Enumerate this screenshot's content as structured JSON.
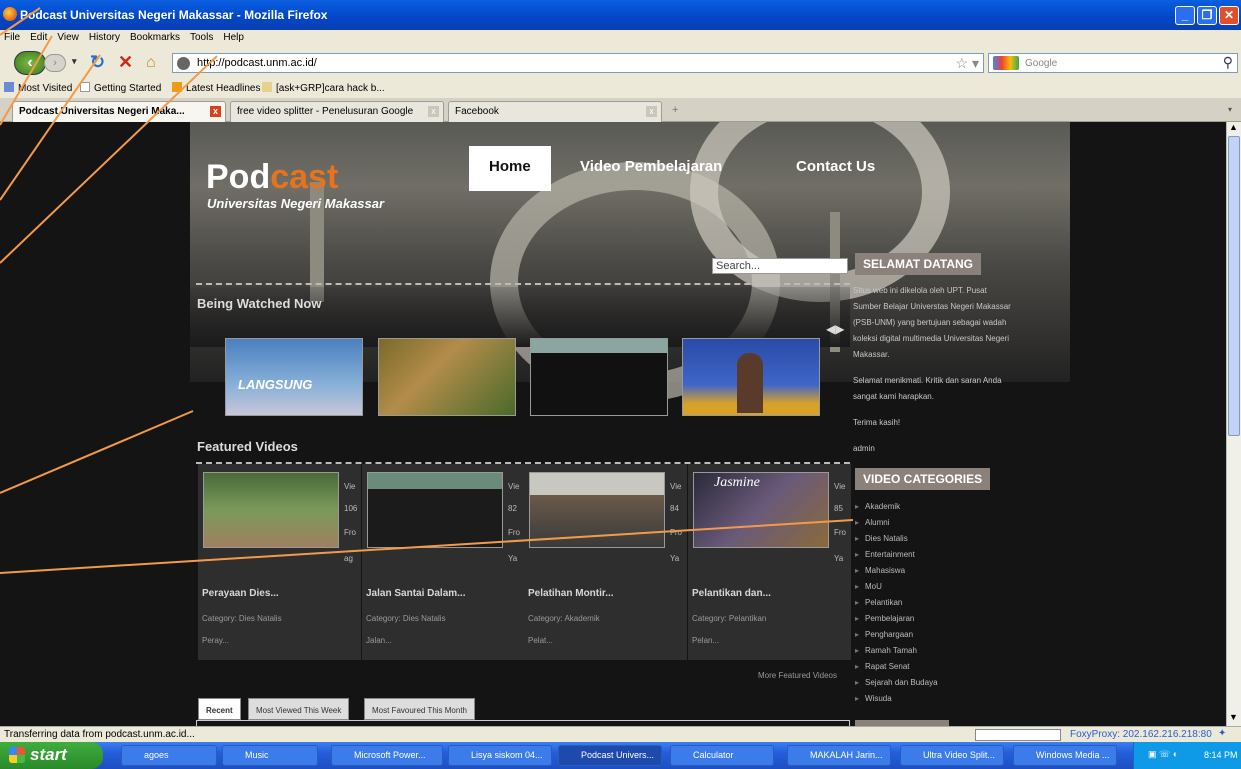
{
  "window": {
    "title": "Podcast Universitas Negeri Makassar - Mozilla Firefox"
  },
  "menu": [
    "File",
    "Edit",
    "View",
    "History",
    "Bookmarks",
    "Tools",
    "Help"
  ],
  "nav": {
    "url": "http://podcast.unm.ac.id/",
    "search_placeholder": "Google"
  },
  "bookmarks": [
    "Most Visited",
    "Getting Started",
    "Latest Headlines",
    "[ask+GRP]cara hack b..."
  ],
  "tabs": [
    "Podcast Universitas Negeri Maka...",
    "free video splitter - Penelusuran Google",
    "Facebook"
  ],
  "site": {
    "logo_main_a": "Pod",
    "logo_main_b": "cast",
    "logo_sub": "Universitas Negeri Makassar",
    "nav": [
      "Home",
      "Video Pembelajaran",
      "Contact Us"
    ],
    "search_value": "Search...",
    "welcome_heading": "SELAMAT DATANG",
    "welcome_text": [
      "Situs web ini dikelola oleh UPT. Pusat",
      "Sumber Belajar Universtas Negeri Makassar",
      "(PSB-UNM) yang bertujuan sebagai wadah",
      "koleksi digital multimedia Universitas Negeri",
      "Makassar."
    ],
    "welcome_text2": [
      "Selamat menikmati. Kritik dan saran Anda",
      "sangat kami harapkan."
    ],
    "thanks": "Terima kasih!",
    "admin": "admin",
    "being_watched": "Being Watched Now",
    "featured": "Featured Videos",
    "categories_heading": "VIDEO CATEGORIES",
    "categories": [
      "Akademik",
      "Alumni",
      "Dies Natalis",
      "Entertainment",
      "Mahasiswa",
      "MoU",
      "Pelantikan",
      "Pembelajaran",
      "Penghargaan",
      "Ramah Tamah",
      "Rapat Senat",
      "Sejarah dan Budaya",
      "Wisuda"
    ],
    "featured_videos": [
      {
        "title": "Perayaan Dies...",
        "category": "Category: Dies Natalis",
        "desc": "Peray...",
        "side": [
          "Vie",
          "106",
          "Fro",
          "ag"
        ]
      },
      {
        "title": "Jalan Santai Dalam...",
        "category": "Category: Dies Natalis",
        "desc": "Jalan...",
        "side": [
          "Vie",
          "82",
          "Fro",
          "Ya"
        ]
      },
      {
        "title": "Pelatihan Montir...",
        "category": "Category: Akademik",
        "desc": "Pelat...",
        "side": [
          "Vie",
          "84",
          "Fro",
          "Ya"
        ]
      },
      {
        "title": "Pelantikan dan...",
        "category": "Category: Pelantikan",
        "desc": "Pelan...",
        "side": [
          "Vie",
          "85",
          "Fro",
          "Ya"
        ]
      }
    ],
    "more_featured": "More Featured Videos",
    "bottom_tabs": [
      "Recent",
      "Most Viewed This Week",
      "Most Favoured This Month"
    ],
    "thumb_texts": [
      "LANGSUNG",
      "Jasmine"
    ]
  },
  "status": {
    "text": "Transferring data from podcast.unm.ac.id...",
    "proxy": "FoxyProxy: 202.162.216.218:80"
  },
  "taskbar": {
    "start": "start",
    "tasks": [
      "agoes",
      "Music",
      "Microsoft Power...",
      "Lisya siskom 04...",
      "Podcast Univers...",
      "Calculator",
      "MAKALAH Jarin...",
      "Ultra Video Split...",
      "Windows Media ..."
    ],
    "clock": "8:14 PM"
  }
}
